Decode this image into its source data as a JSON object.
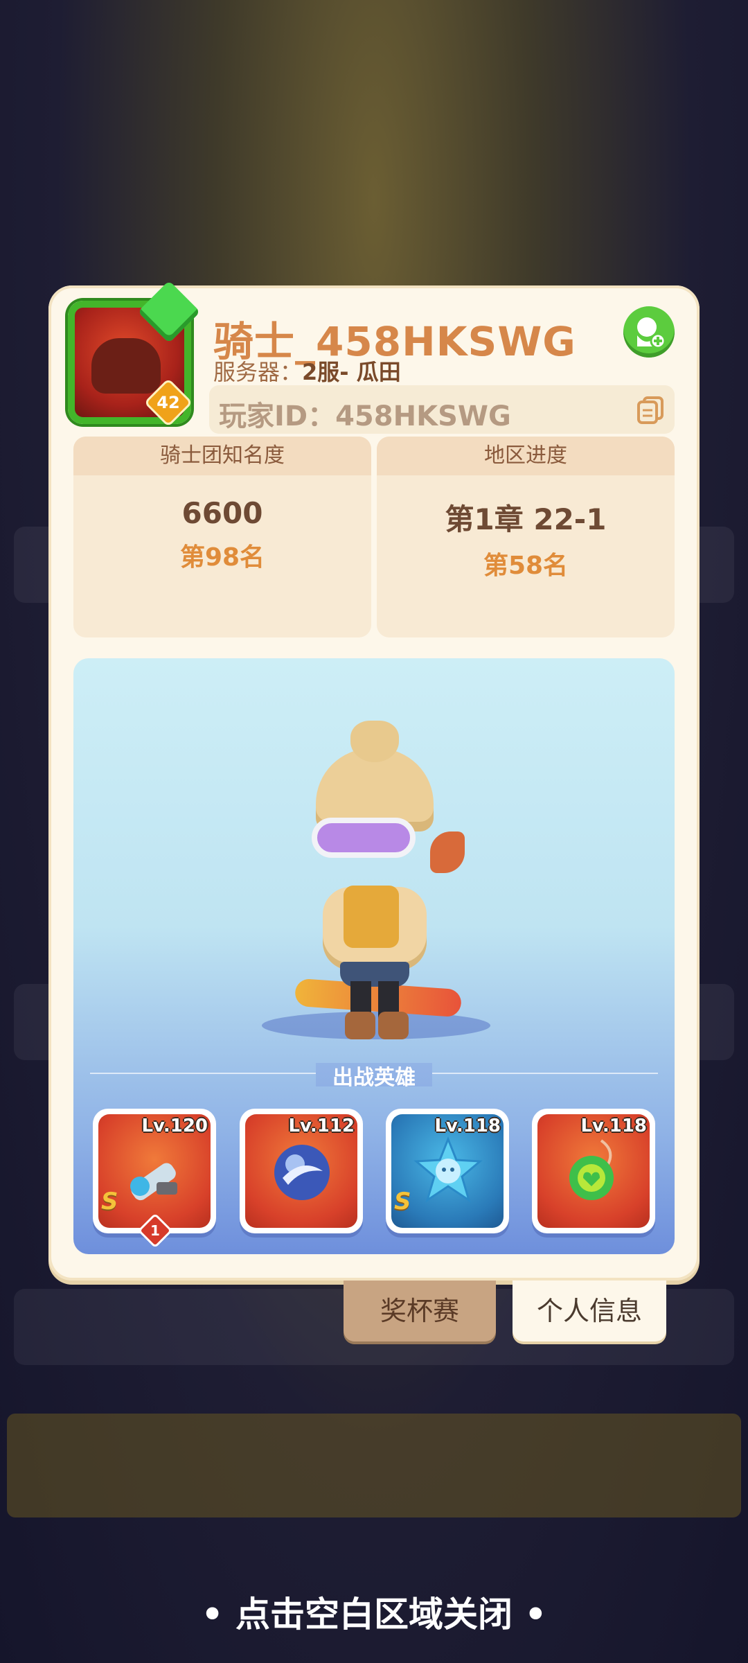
{
  "profile": {
    "name": "骑士_458HKSWG",
    "server_label": "服务器：",
    "server_value": "2服- 瓜田",
    "player_id_label": "玩家ID：",
    "player_id": "458HKSWG",
    "avatar_level": "42"
  },
  "stats": {
    "fame": {
      "label": "骑士团知名度",
      "value": "6600",
      "rank": "第98名"
    },
    "progress": {
      "label": "地区进度",
      "value": "第1章 22-1",
      "rank": "第58名"
    }
  },
  "heroes_section": {
    "title": "出战英雄",
    "items": [
      {
        "level": "Lv.120",
        "rarity": "S",
        "icon": "blaster-icon",
        "notice": "1"
      },
      {
        "level": "Lv.112",
        "rarity": "",
        "icon": "orb-icon",
        "notice": ""
      },
      {
        "level": "Lv.118",
        "rarity": "S",
        "icon": "star-badge-icon",
        "notice": ""
      },
      {
        "level": "Lv.118",
        "rarity": "",
        "icon": "heart-pendant-icon",
        "notice": ""
      }
    ]
  },
  "tabs": {
    "trophy": "奖杯赛",
    "personal": "个人信息"
  },
  "close_hint": "• 点击空白区域关闭 •",
  "colors": {
    "name": "#d6874a",
    "rank": "#e08c3a",
    "add_friend": "#5ccc3e",
    "card": "#fdf7ea"
  }
}
